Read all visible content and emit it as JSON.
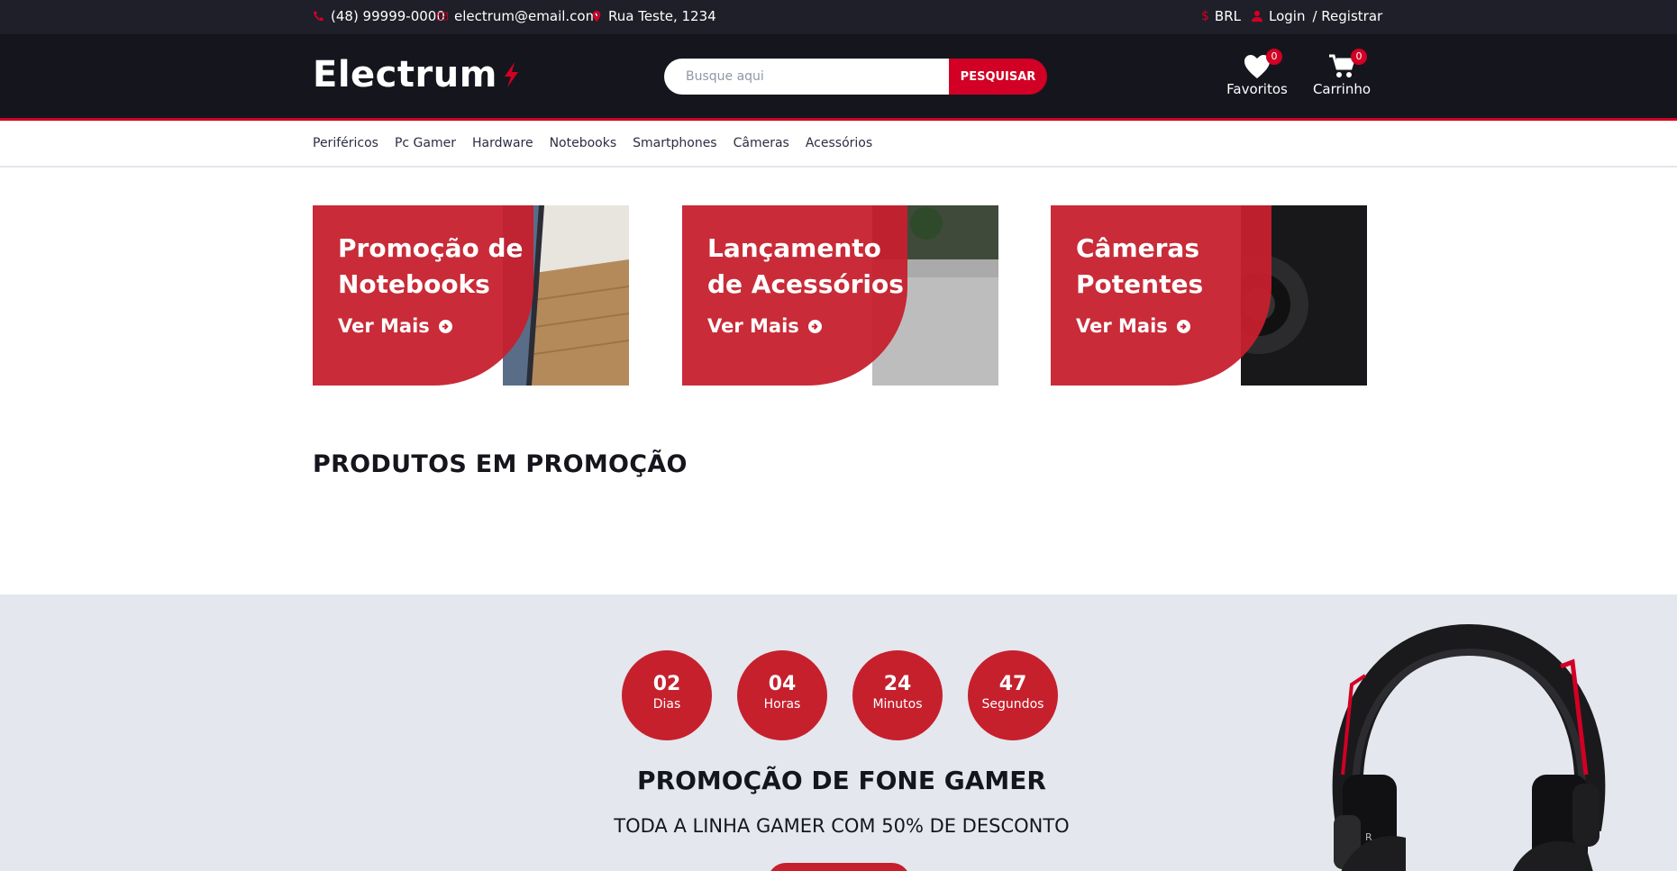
{
  "topbar": {
    "phone": "(48) 99999-0000",
    "email": "electrum@email.com",
    "address": "Rua Teste, 1234",
    "currency": "BRL",
    "login": "Login",
    "register": "/ Registrar"
  },
  "header": {
    "logo": "Electrum",
    "search_placeholder": "Busque aqui",
    "search_button": "PESQUISAR",
    "favorites_label": "Favoritos",
    "favorites_count": "0",
    "cart_label": "Carrinho",
    "cart_count": "0"
  },
  "nav": {
    "items": [
      "Periféricos",
      "Pc Gamer",
      "Hardware",
      "Notebooks",
      "Smartphones",
      "Câmeras",
      "Acessórios"
    ]
  },
  "promos": [
    {
      "title": "Promoção de Notebooks",
      "link": "Ver Mais"
    },
    {
      "title": "Lançamento de Acessórios",
      "link": "Ver Mais"
    },
    {
      "title": "Câmeras Potentes",
      "link": "Ver Mais"
    }
  ],
  "section_title": "PRODUTOS EM PROMOÇÃO",
  "deal": {
    "countdown": [
      {
        "value": "02",
        "label": "Dias"
      },
      {
        "value": "04",
        "label": "Horas"
      },
      {
        "value": "24",
        "label": "Minutos"
      },
      {
        "value": "47",
        "label": "Segundos"
      }
    ],
    "title": "PROMOÇÃO DE FONE GAMER",
    "subtitle": "TODA A LINHA GAMER COM 50% DE DESCONTO"
  },
  "colors": {
    "accent": "#d10024",
    "dark": "#15161d",
    "topbar": "#1e1f29",
    "deal_bg": "#e4e7ed"
  }
}
